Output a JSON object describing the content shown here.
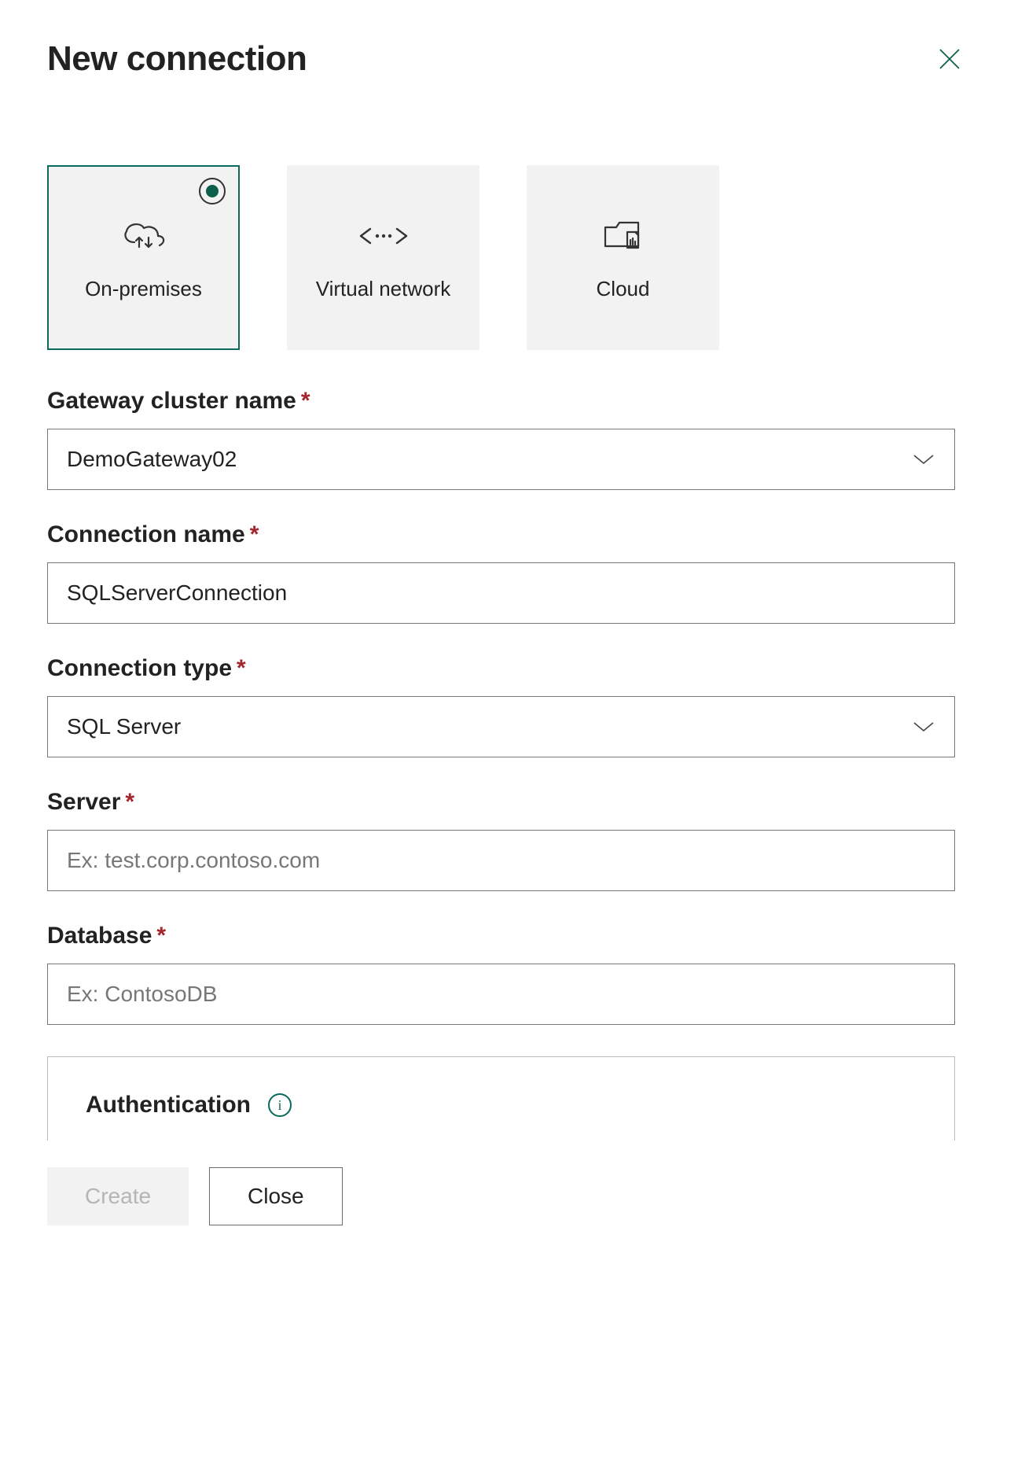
{
  "header": {
    "title": "New connection"
  },
  "cards": {
    "on_premises": {
      "label": "On-premises",
      "selected": true
    },
    "virtual_network": {
      "label": "Virtual network",
      "selected": false
    },
    "cloud": {
      "label": "Cloud",
      "selected": false
    }
  },
  "fields": {
    "gateway_cluster": {
      "label": "Gateway cluster name",
      "required": true,
      "value": "DemoGateway02"
    },
    "connection_name": {
      "label": "Connection name",
      "required": true,
      "value": "SQLServerConnection"
    },
    "connection_type": {
      "label": "Connection type",
      "required": true,
      "value": "SQL Server"
    },
    "server": {
      "label": "Server",
      "required": true,
      "placeholder": "Ex: test.corp.contoso.com",
      "value": ""
    },
    "database": {
      "label": "Database",
      "required": true,
      "placeholder": "Ex: ContosoDB",
      "value": ""
    }
  },
  "auth": {
    "title": "Authentication"
  },
  "footer": {
    "create": "Create",
    "close": "Close"
  },
  "required_mark": "*"
}
